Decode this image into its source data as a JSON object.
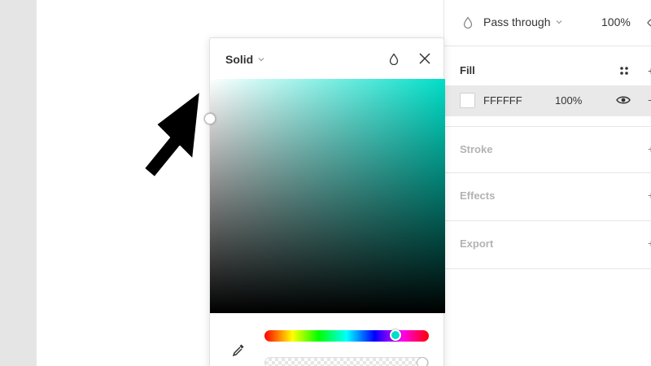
{
  "layer": {
    "blend_mode": "Pass through",
    "opacity": "100%"
  },
  "fill": {
    "title": "Fill",
    "hex": "FFFFFF",
    "opacity": "100%",
    "swatch_color": "#FFFFFF"
  },
  "sections": {
    "stroke": "Stroke",
    "effects": "Effects",
    "export": "Export"
  },
  "picker": {
    "mode": "Solid",
    "hue_color": "#00DEC8"
  },
  "icons": {
    "blend": "drop-icon",
    "styles": "four-dots-icon",
    "visibility": "eye-icon",
    "close": "close-icon",
    "eyedropper": "eyedropper-icon",
    "annotation": "arrow-pointer"
  }
}
